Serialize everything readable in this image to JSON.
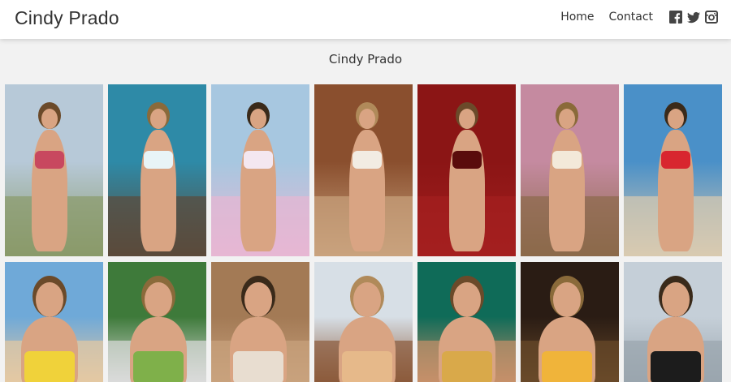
{
  "header": {
    "brand": "Cindy Prado",
    "nav": [
      {
        "label": "Home"
      },
      {
        "label": "Contact"
      }
    ],
    "social_icons": [
      "facebook-icon",
      "twitter-icon",
      "instagram-icon"
    ]
  },
  "gallery": {
    "title": "Cindy Prado",
    "rows": [
      [
        {
          "scene": "vespa-garden",
          "top": "#b7c9d8",
          "bottom": "#8a9a6a",
          "accent": "#c8485f"
        },
        {
          "scene": "ocean-splash",
          "top": "#2e8aa7",
          "bottom": "#5b4a3a",
          "accent": "#e8f4f7"
        },
        {
          "scene": "pink-jeep",
          "top": "#a7c7e0",
          "bottom": "#e7b7d3",
          "accent": "#f4e7f0"
        },
        {
          "scene": "wooden-door",
          "top": "#8a4f2e",
          "bottom": "#c9a27e",
          "accent": "#f2ece3"
        },
        {
          "scene": "red-corset",
          "top": "#8b1515",
          "bottom": "#a41f1f",
          "accent": "#5a0c0c"
        },
        {
          "scene": "floral-bikini",
          "top": "#c58aa0",
          "bottom": "#8b6a4a",
          "accent": "#f3e9d9"
        },
        {
          "scene": "beach-red",
          "top": "#4a90c8",
          "bottom": "#d9cab0",
          "accent": "#d8262f"
        }
      ],
      [
        {
          "scene": "yellow-swim",
          "top": "#6fa9d8",
          "bottom": "#e6c9a2",
          "accent": "#f0d23a"
        },
        {
          "scene": "palm-pool",
          "top": "#3e7a3a",
          "bottom": "#dcdcdc",
          "accent": "#7fb04a"
        },
        {
          "scene": "rocks",
          "top": "#a37a55",
          "bottom": "#c9a27e",
          "accent": "#e8ddd0"
        },
        {
          "scene": "drink-portrait",
          "top": "#d7dfe6",
          "bottom": "#8b5a3a",
          "accent": "#e6b98a"
        },
        {
          "scene": "green-portrait",
          "top": "#0f6b58",
          "bottom": "#c7906a",
          "accent": "#d9a94a"
        },
        {
          "scene": "night-city",
          "top": "#2a1c14",
          "bottom": "#6a4a2a",
          "accent": "#f0b43a"
        },
        {
          "scene": "street-black",
          "top": "#c5cfd8",
          "bottom": "#9aa5ae",
          "accent": "#1c1c1c"
        }
      ]
    ]
  }
}
